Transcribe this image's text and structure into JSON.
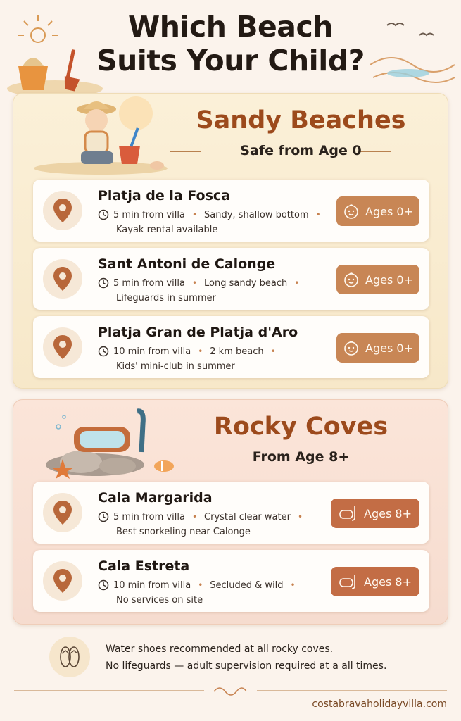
{
  "header": {
    "title_line1": "Which Beach",
    "title_line2": "Suits Your Child?"
  },
  "sandy": {
    "title": "Sandy Beaches",
    "subtitle": "Safe from Age 0",
    "beaches": [
      {
        "name": "Platja de la Fosca",
        "time": "5 min from villa",
        "detail": "Sandy, shallow bottom",
        "extra": "Kayak rental available",
        "badge": "Ages 0+"
      },
      {
        "name": "Sant Antoni de Calonge",
        "time": "5 min from villa",
        "detail": "Long sandy beach",
        "extra": "Lifeguards in summer",
        "badge": "Ages 0+"
      },
      {
        "name": "Platja Gran de Platja d'Aro",
        "time": "10 min from villa",
        "detail": "2 km beach",
        "extra": "Kids' mini-club in summer",
        "badge": "Ages 0+"
      }
    ]
  },
  "rocky": {
    "title": "Rocky Coves",
    "subtitle": "From Age 8+",
    "coves": [
      {
        "name": "Cala Margarida",
        "time": "5 min from villa",
        "detail": "Crystal clear water",
        "extra": "Best snorkeling near Calonge",
        "badge": "Ages 8+"
      },
      {
        "name": "Cala Estreta",
        "time": "10 min from villa",
        "detail": "Secluded & wild",
        "extra": "No services on site",
        "badge": "Ages 8+"
      }
    ]
  },
  "footer": {
    "note_line1": "Water shoes recommended at all rocky coves.",
    "note_line2": "No lifeguards — adult supervision required at a all times.",
    "site": "costabravaholidayvilla.com"
  },
  "colors": {
    "accent": "#9c4a1c",
    "sandy_badge": "#c88655",
    "rocky_badge": "#c36d45",
    "background": "#fbf3ec"
  },
  "icons": {
    "location": "location-pin-icon",
    "clock": "clock-icon",
    "baby": "baby-face-icon",
    "snorkel": "snorkel-mask-icon",
    "flipflops": "flip-flops-icon"
  }
}
